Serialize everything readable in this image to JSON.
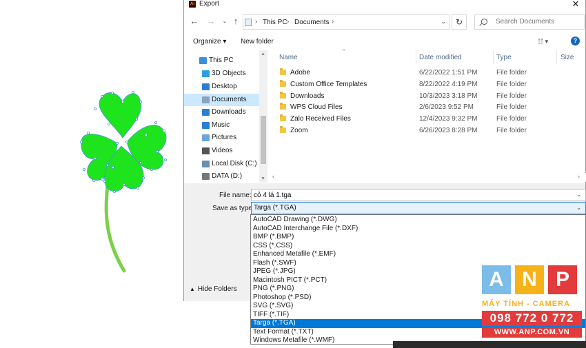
{
  "window": {
    "title": "Export",
    "close_label": "✕",
    "app_icon": "Ai"
  },
  "address": {
    "crumbs": [
      "This PC",
      "Documents"
    ],
    "search_placeholder": "Search Documents"
  },
  "toolbar": {
    "organize": "Organize ▾",
    "new_folder": "New folder",
    "view_icon": "☷ ▾",
    "help": "?"
  },
  "nav": {
    "items": [
      {
        "label": "This PC",
        "icon": "computer-icon",
        "color": "#3a8fd9"
      },
      {
        "label": "3D Objects",
        "icon": "cube-icon",
        "color": "#2aa0e0"
      },
      {
        "label": "Desktop",
        "icon": "desktop-icon",
        "color": "#2a7fd0"
      },
      {
        "label": "Documents",
        "icon": "documents-icon",
        "color": "#8aa3bf"
      },
      {
        "label": "Downloads",
        "icon": "download-icon",
        "color": "#2a7fd0"
      },
      {
        "label": "Music",
        "icon": "music-icon",
        "color": "#2a7fd0"
      },
      {
        "label": "Pictures",
        "icon": "pictures-icon",
        "color": "#6aa6d9"
      },
      {
        "label": "Videos",
        "icon": "videos-icon",
        "color": "#555555"
      },
      {
        "label": "Local Disk (C:)",
        "icon": "disk-icon",
        "color": "#6a8fb0"
      },
      {
        "label": "DATA (D:)",
        "icon": "disk-icon",
        "color": "#777777"
      }
    ]
  },
  "files": {
    "columns": {
      "name": "Name",
      "date": "Date modified",
      "type": "Type",
      "size": "Size"
    },
    "rows": [
      {
        "name": "Adobe",
        "date": "6/22/2022 1:51 PM",
        "type": "File folder"
      },
      {
        "name": "Custom Office Templates",
        "date": "8/22/2022 4:19 PM",
        "type": "File folder"
      },
      {
        "name": "Downloads",
        "date": "10/3/2023 3:18 PM",
        "type": "File folder"
      },
      {
        "name": "WPS Cloud Files",
        "date": "2/6/2023 9:52 PM",
        "type": "File folder"
      },
      {
        "name": "Zalo Received Files",
        "date": "12/4/2023 9:32 PM",
        "type": "File folder"
      },
      {
        "name": "Zoom",
        "date": "6/26/2023 8:28 PM",
        "type": "File folder"
      }
    ]
  },
  "save": {
    "file_name_label": "File name:",
    "file_name_value": "cỏ 4 lá 1.tga",
    "save_type_label": "Save as type:",
    "save_type_value": "Targa (*.TGA)",
    "hide_folders": "Hide Folders"
  },
  "type_options": [
    "AutoCAD Drawing (*.DWG)",
    "AutoCAD Interchange File (*.DXF)",
    "BMP (*.BMP)",
    "CSS (*.CSS)",
    "Enhanced Metafile (*.EMF)",
    "Flash (*.SWF)",
    "JPEG (*.JPG)",
    "Macintosh PICT (*.PCT)",
    "PNG (*.PNG)",
    "Photoshop (*.PSD)",
    "SVG (*.SVG)",
    "TIFF (*.TIF)",
    "Targa (*.TGA)",
    "Text Format (*.TXT)",
    "Windows Metafile (*.WMF)"
  ],
  "selected_type_index": 12,
  "watermark": {
    "letters": [
      "A",
      "N",
      "P"
    ],
    "tagline": "MÁY TÍNH - CAMERA",
    "phone": "098 772 0 772",
    "website": "WWW.ANP.COM.VN"
  }
}
